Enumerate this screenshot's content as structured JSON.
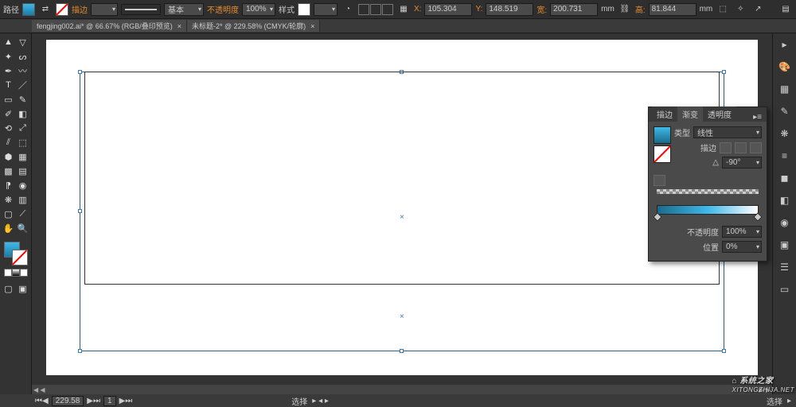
{
  "toolbar": {
    "path_label": "路径",
    "stroke_label": "描边",
    "stroke_weight": "",
    "basic_label": "基本",
    "opacity_label": "不透明度",
    "opacity_value": "100%",
    "style_label": "样式",
    "x_label": "X:",
    "x_value": "105.304",
    "y_label": "Y:",
    "y_value": "148.519",
    "w_label": "宽:",
    "w_value": "200.731",
    "h_label": "高:",
    "h_value": "81.844",
    "mm1": "mm",
    "mm2": "mm"
  },
  "tabs": [
    "fengjing002.ai* @ 66.67% (RGB/叠印预览)",
    "未标题-2* @ 229.58% (CMYK/轮廓)"
  ],
  "gradient_panel": {
    "tab_stroke": "描边",
    "tab_gradient": "渐变",
    "tab_opacity": "透明度",
    "type_label": "类型",
    "type_value": "线性",
    "stroke_label2": "描边",
    "angle_value": "-90°",
    "opacity_label2": "不透明度",
    "opacity_value2": "100%",
    "location_label": "位置",
    "location_value": "0%"
  },
  "status": {
    "zoom": "229.58",
    "layer": "1",
    "select1": "选择",
    "select2": "选择"
  },
  "watermark": {
    "text1": "系统之家",
    "text2": "XITONGZHIJA.NET"
  }
}
